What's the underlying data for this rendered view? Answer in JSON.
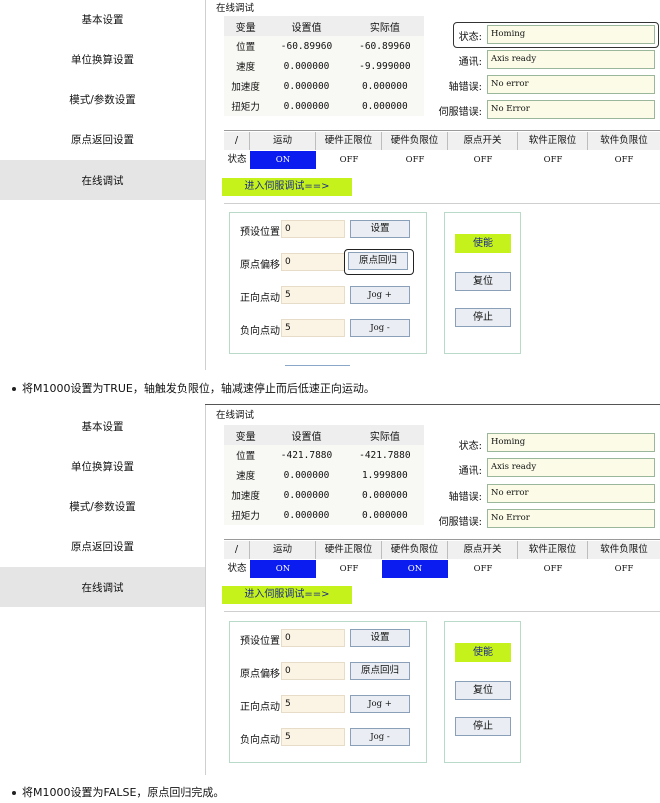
{
  "panels": [
    {
      "sidebar": [
        "基本设置",
        "单位换算设置",
        "模式/参数设置",
        "原点返回设置",
        "在线调试"
      ],
      "active_index": 4,
      "group_title": "在线调试",
      "vars_header": [
        "变量",
        "设置值",
        "实际值"
      ],
      "vars": [
        {
          "name": "位置",
          "set": "-60.89960",
          "actual": "-60.89960"
        },
        {
          "name": "速度",
          "set": "0.000000",
          "actual": "-9.999000"
        },
        {
          "name": "加速度",
          "set": "0.000000",
          "actual": "0.000000"
        },
        {
          "name": "扭矩力",
          "set": "0.000000",
          "actual": "0.000000"
        }
      ],
      "status": [
        {
          "label": "状态:",
          "value": "Homing"
        },
        {
          "label": "通讯:",
          "value": "Axis ready"
        },
        {
          "label": "轴错误:",
          "value": "No error"
        },
        {
          "label": "伺服错误:",
          "value": "No Error"
        }
      ],
      "io_header": [
        "/",
        "运动",
        "硬件正限位",
        "硬件负限位",
        "原点开关",
        "软件正限位",
        "软件负限位"
      ],
      "io_label": "状态",
      "io_values": [
        "ON",
        "OFF",
        "OFF",
        "OFF",
        "OFF",
        "OFF"
      ],
      "io_on": [
        true,
        false,
        false,
        false,
        false,
        false
      ],
      "enter_servo": "进入伺服调试==>",
      "params": [
        {
          "label": "预设位置",
          "value": "0",
          "button": "设置"
        },
        {
          "label": "原点偏移",
          "value": "0",
          "button": "原点回归"
        },
        {
          "label": "正向点动",
          "value": "5",
          "button": "Jog +"
        },
        {
          "label": "负向点动",
          "value": "5",
          "button": "Jog -"
        }
      ],
      "controls": [
        "使能",
        "复位",
        "停止"
      ],
      "caption": "将M1000设置为TRUE，轴触发负限位，轴减速停止而后低速正向运动。"
    },
    {
      "sidebar": [
        "基本设置",
        "单位换算设置",
        "模式/参数设置",
        "原点返回设置",
        "在线调试"
      ],
      "active_index": 4,
      "group_title": "在线调试",
      "vars_header": [
        "变量",
        "设置值",
        "实际值"
      ],
      "vars": [
        {
          "name": "位置",
          "set": "-421.7880",
          "actual": "-421.7880"
        },
        {
          "name": "速度",
          "set": "0.000000",
          "actual": "1.999800"
        },
        {
          "name": "加速度",
          "set": "0.000000",
          "actual": "0.000000"
        },
        {
          "name": "扭矩力",
          "set": "0.000000",
          "actual": "0.000000"
        }
      ],
      "status": [
        {
          "label": "状态:",
          "value": "Homing"
        },
        {
          "label": "通讯:",
          "value": "Axis ready"
        },
        {
          "label": "轴错误:",
          "value": "No error"
        },
        {
          "label": "伺服错误:",
          "value": "No Error"
        }
      ],
      "io_header": [
        "/",
        "运动",
        "硬件正限位",
        "硬件负限位",
        "原点开关",
        "软件正限位",
        "软件负限位"
      ],
      "io_label": "状态",
      "io_values": [
        "ON",
        "OFF",
        "ON",
        "OFF",
        "OFF",
        "OFF"
      ],
      "io_on": [
        true,
        false,
        true,
        false,
        false,
        false
      ],
      "enter_servo": "进入伺服调试==>",
      "params": [
        {
          "label": "预设位置",
          "value": "0",
          "button": "设置"
        },
        {
          "label": "原点偏移",
          "value": "0",
          "button": "原点回归"
        },
        {
          "label": "正向点动",
          "value": "5",
          "button": "Jog +"
        },
        {
          "label": "负向点动",
          "value": "5",
          "button": "Jog -"
        }
      ],
      "controls": [
        "使能",
        "复位",
        "停止"
      ],
      "caption": "将M1000设置为FALSE，原点回归完成。"
    }
  ],
  "colors": {
    "on": "#0b1cf0",
    "accent": "#c6f21b",
    "active_sidebar": "#e5e5e5"
  }
}
